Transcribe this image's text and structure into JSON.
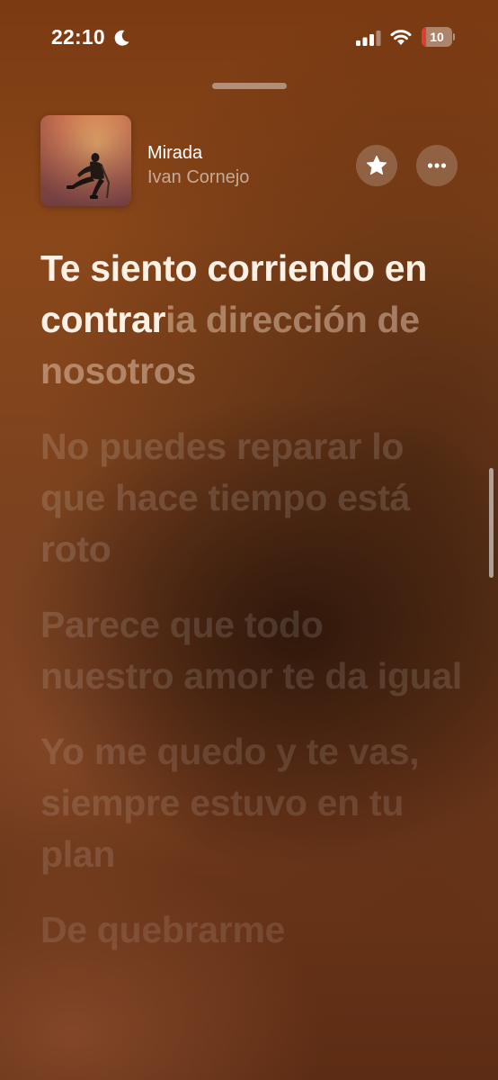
{
  "status_bar": {
    "time": "22:10",
    "battery_level": "10",
    "battery_fraction": 0.1,
    "battery_color": "#e23b30",
    "icons": [
      "moon-icon",
      "signal-icon",
      "wifi-icon",
      "battery-icon"
    ]
  },
  "now_playing": {
    "title": "Mirada",
    "artist": "Ivan Cornejo",
    "buttons": [
      "favorite-star-icon",
      "more-ellipsis-icon"
    ]
  },
  "lyrics": {
    "current": {
      "sung": "Te siento corriendo en contrar",
      "unsung": "ia dirección de nosotros"
    },
    "upcoming": [
      "No puedes reparar lo que hace tiempo está roto",
      "Parece que todo nuestro amor te da igual",
      "Yo me quedo y te vas, siempre estuvo en tu plan",
      "De quebrarme"
    ]
  }
}
